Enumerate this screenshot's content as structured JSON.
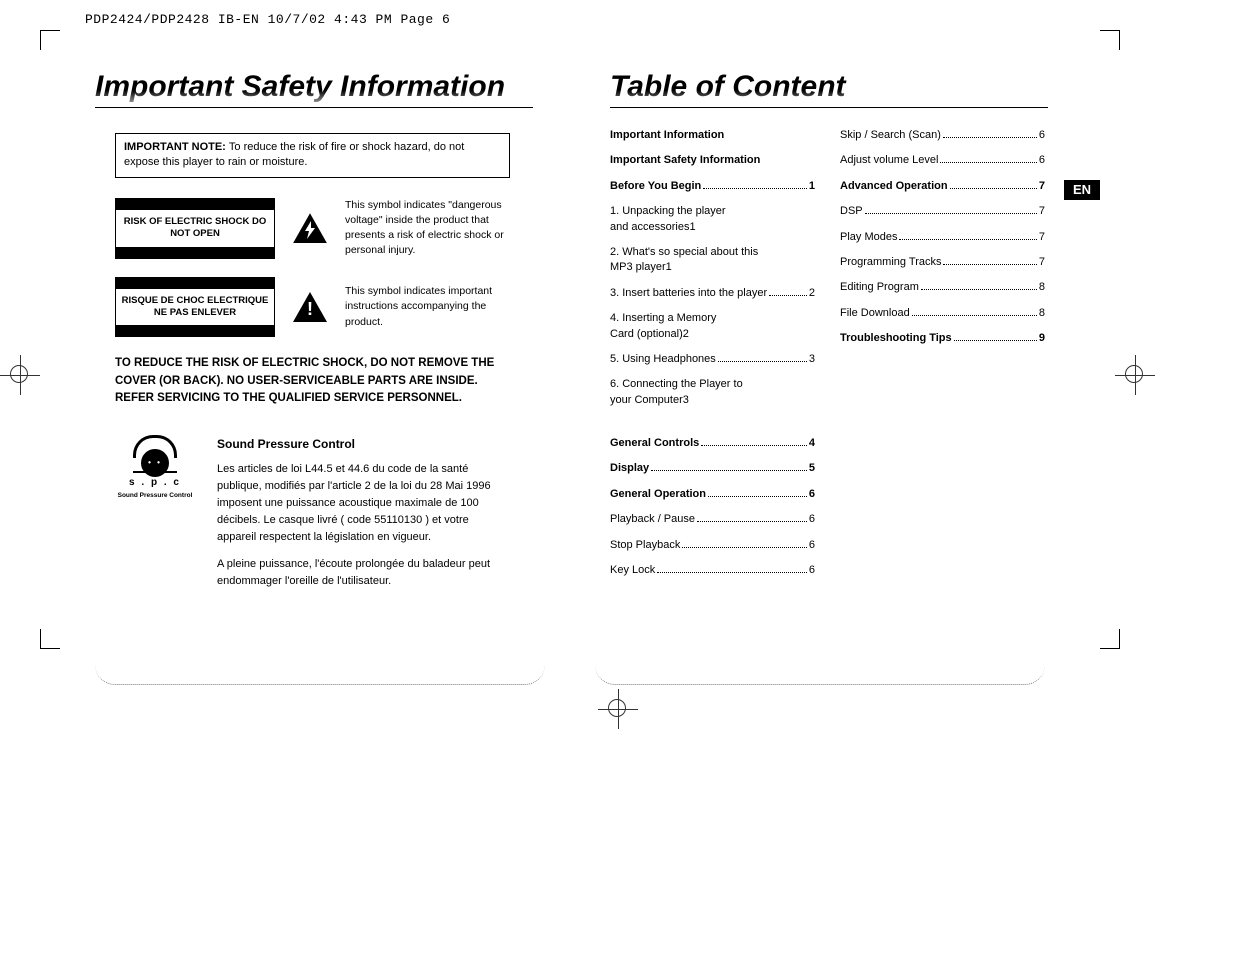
{
  "print_header": "PDP2424/PDP2428 IB-EN  10/7/02  4:43 PM  Page 6",
  "left": {
    "title": "Important Safety Information",
    "note_label": "IMPORTANT NOTE:",
    "note_body": "To reduce the risk of fire or shock hazard, do not expose this player to rain or moisture.",
    "warn1_label": "RISK OF ELECTRIC SHOCK DO NOT OPEN",
    "warn1_text": "This symbol indicates \"dangerous voltage\" inside the product that presents a risk of electric shock or personal injury.",
    "warn2_label": "RISQUE DE CHOC ELECTRIQUE NE PAS ENLEVER",
    "warn2_text": "This symbol indicates important instructions accompanying the product.",
    "cover_warning": "TO REDUCE THE RISK OF ELECTRIC SHOCK, DO NOT REMOVE THE COVER (OR BACK). NO USER-SERVICEABLE PARTS ARE INSIDE. REFER SERVICING TO THE QUALIFIED SERVICE PERSONNEL.",
    "spc_heading": "Sound Pressure Control",
    "spc_logo_text": "s . p . c",
    "spc_logo_caption": "Sound Pressure Control",
    "spc_p1": "Les articles de loi L44.5 et 44.6 du code de la santé publique, modifiés par l'article 2 de la loi du 28 Mai 1996 imposent une puissance acoustique maximale de 100 décibels. Le casque livré ( code 55110130 ) et votre appareil respectent la législation en vigueur.",
    "spc_p2": "A pleine puissance, l'écoute prolongée du baladeur peut endommager l'oreille de l'utilisateur."
  },
  "right": {
    "title": "Table of Content",
    "en_tab": "EN",
    "toc_left": [
      {
        "label": "Important Information",
        "page": "",
        "bold": true,
        "nopage": true
      },
      {
        "label": "Important Safety Information",
        "page": "",
        "bold": true,
        "nopage": true
      },
      {
        "label": "Before You Begin",
        "page": "1",
        "bold": true
      },
      {
        "label": "1.  Unpacking the player and accessories",
        "page": "1",
        "multiline": true
      },
      {
        "label": "2.  What's so special about this MP3 player",
        "page": "1",
        "multiline": true
      },
      {
        "label": "3.  Insert batteries into the player",
        "page": "2"
      },
      {
        "label": "4.  Inserting a Memory Card (optional)",
        "page": "2",
        "multiline": true
      },
      {
        "label": "5.   Using Headphones",
        "page": "3"
      },
      {
        "label": "6.   Connecting the Player to your Computer",
        "page": "3",
        "multiline": true,
        "gap_after": true
      },
      {
        "label": "General Controls",
        "page": "4",
        "bold": true
      },
      {
        "label": "Display",
        "page": "5",
        "bold": true
      },
      {
        "label": "General Operation",
        "page": "6",
        "bold": true
      },
      {
        "label": "Playback / Pause",
        "page": "6"
      },
      {
        "label": "Stop Playback",
        "page": "6"
      },
      {
        "label": "Key Lock",
        "page": "6"
      }
    ],
    "toc_right": [
      {
        "label": "Skip / Search (Scan)",
        "page": "6"
      },
      {
        "label": "Adjust volume Level",
        "page": "6"
      },
      {
        "label": "Advanced Operation",
        "page": "7",
        "bold": true
      },
      {
        "label": "DSP",
        "page": "7"
      },
      {
        "label": "Play Modes",
        "page": "7"
      },
      {
        "label": "Programming Tracks",
        "page": "7"
      },
      {
        "label": "Editing Program",
        "page": "8"
      },
      {
        "label": "File Download",
        "page": "8"
      },
      {
        "label": "Troubleshooting Tips",
        "page": "9",
        "bold": true
      }
    ]
  }
}
